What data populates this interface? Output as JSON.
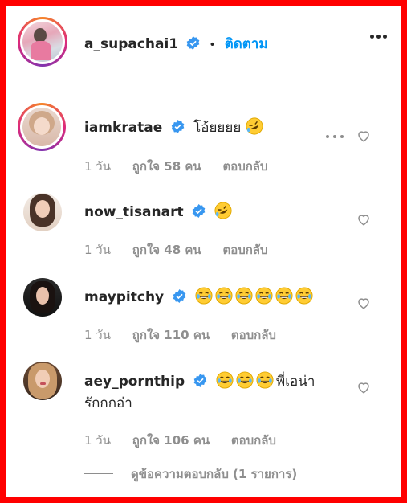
{
  "post_header": {
    "username": "a_supachai1",
    "verified": true,
    "separator": "•",
    "follow_label": "ติดตาม"
  },
  "comments": [
    {
      "username": "iamkratae",
      "verified": true,
      "text": "โอ้ยยยย",
      "emojis": [
        "rofl-emoji"
      ],
      "time": "1 วัน",
      "likes": "ถูกใจ 58 คน",
      "reply": "ตอบกลับ",
      "story_ring": true
    },
    {
      "username": "now_tisanart",
      "verified": true,
      "text": "",
      "emojis": [
        "rofl-emoji"
      ],
      "time": "1 วัน",
      "likes": "ถูกใจ 48 คน",
      "reply": "ตอบกลับ"
    },
    {
      "username": "maypitchy",
      "verified": true,
      "text": "",
      "emojis": [
        "joy-emoji",
        "joy-emoji",
        "joy-emoji",
        "joy-emoji",
        "joy-emoji",
        "joy-emoji"
      ],
      "time": "1 วัน",
      "likes": "ถูกใจ 110 คน",
      "reply": "ตอบกลับ"
    },
    {
      "username": "aey_pornthip",
      "verified": true,
      "text": "พี่เอน่า",
      "text_line2": "รักกกอ่า",
      "emojis": [
        "joy-emoji",
        "joy-emoji",
        "joy-emoji"
      ],
      "time": "1 วัน",
      "likes": "ถูกใจ 106 คน",
      "reply": "ตอบกลับ"
    }
  ],
  "view_replies": "ดูข้อความตอบกลับ (1 รายการ)",
  "colors": {
    "frame": "#ff0000",
    "link": "#0095f6",
    "verified": "#3897f0",
    "muted": "#8e8e8e",
    "text": "#262626"
  }
}
